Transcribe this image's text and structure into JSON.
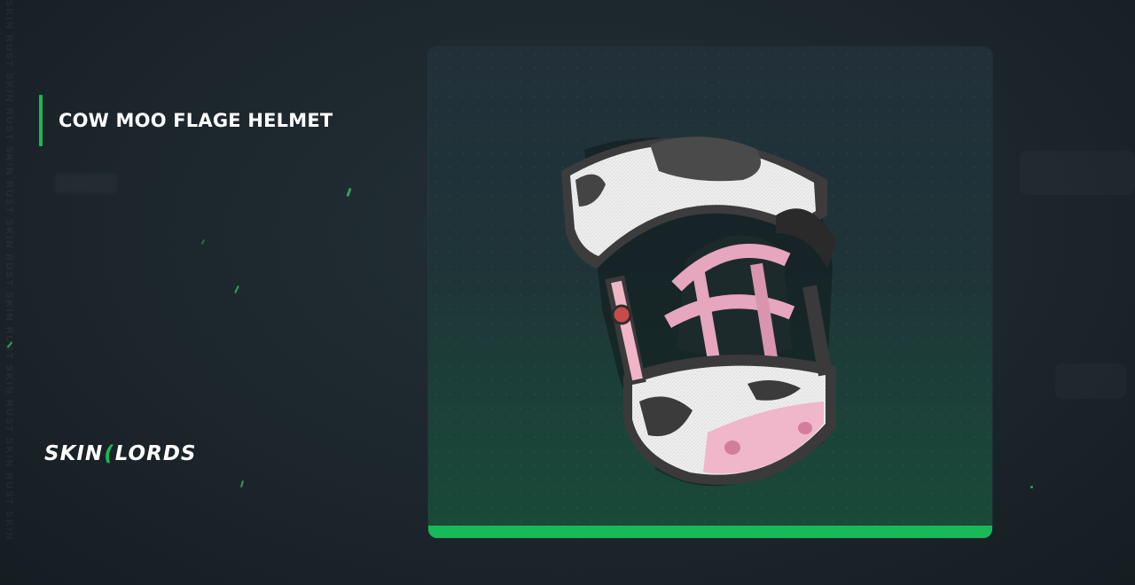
{
  "side_watermark": "SKIN RUST SKIN RUST SKIN RUST SKIN RUST SKIN RUST SKIN RUST SKIN RUST SKIN",
  "item": {
    "title": "COW MOO FLAGE HELMET",
    "image_icon": "cow-helmet-image"
  },
  "brand": {
    "part1": "SKIN",
    "separator": "(",
    "part2": "LORDS"
  },
  "colors": {
    "accent": "#18b957",
    "background": "#1c262c",
    "card_top": "#22303a",
    "card_bottom": "#194a38"
  }
}
